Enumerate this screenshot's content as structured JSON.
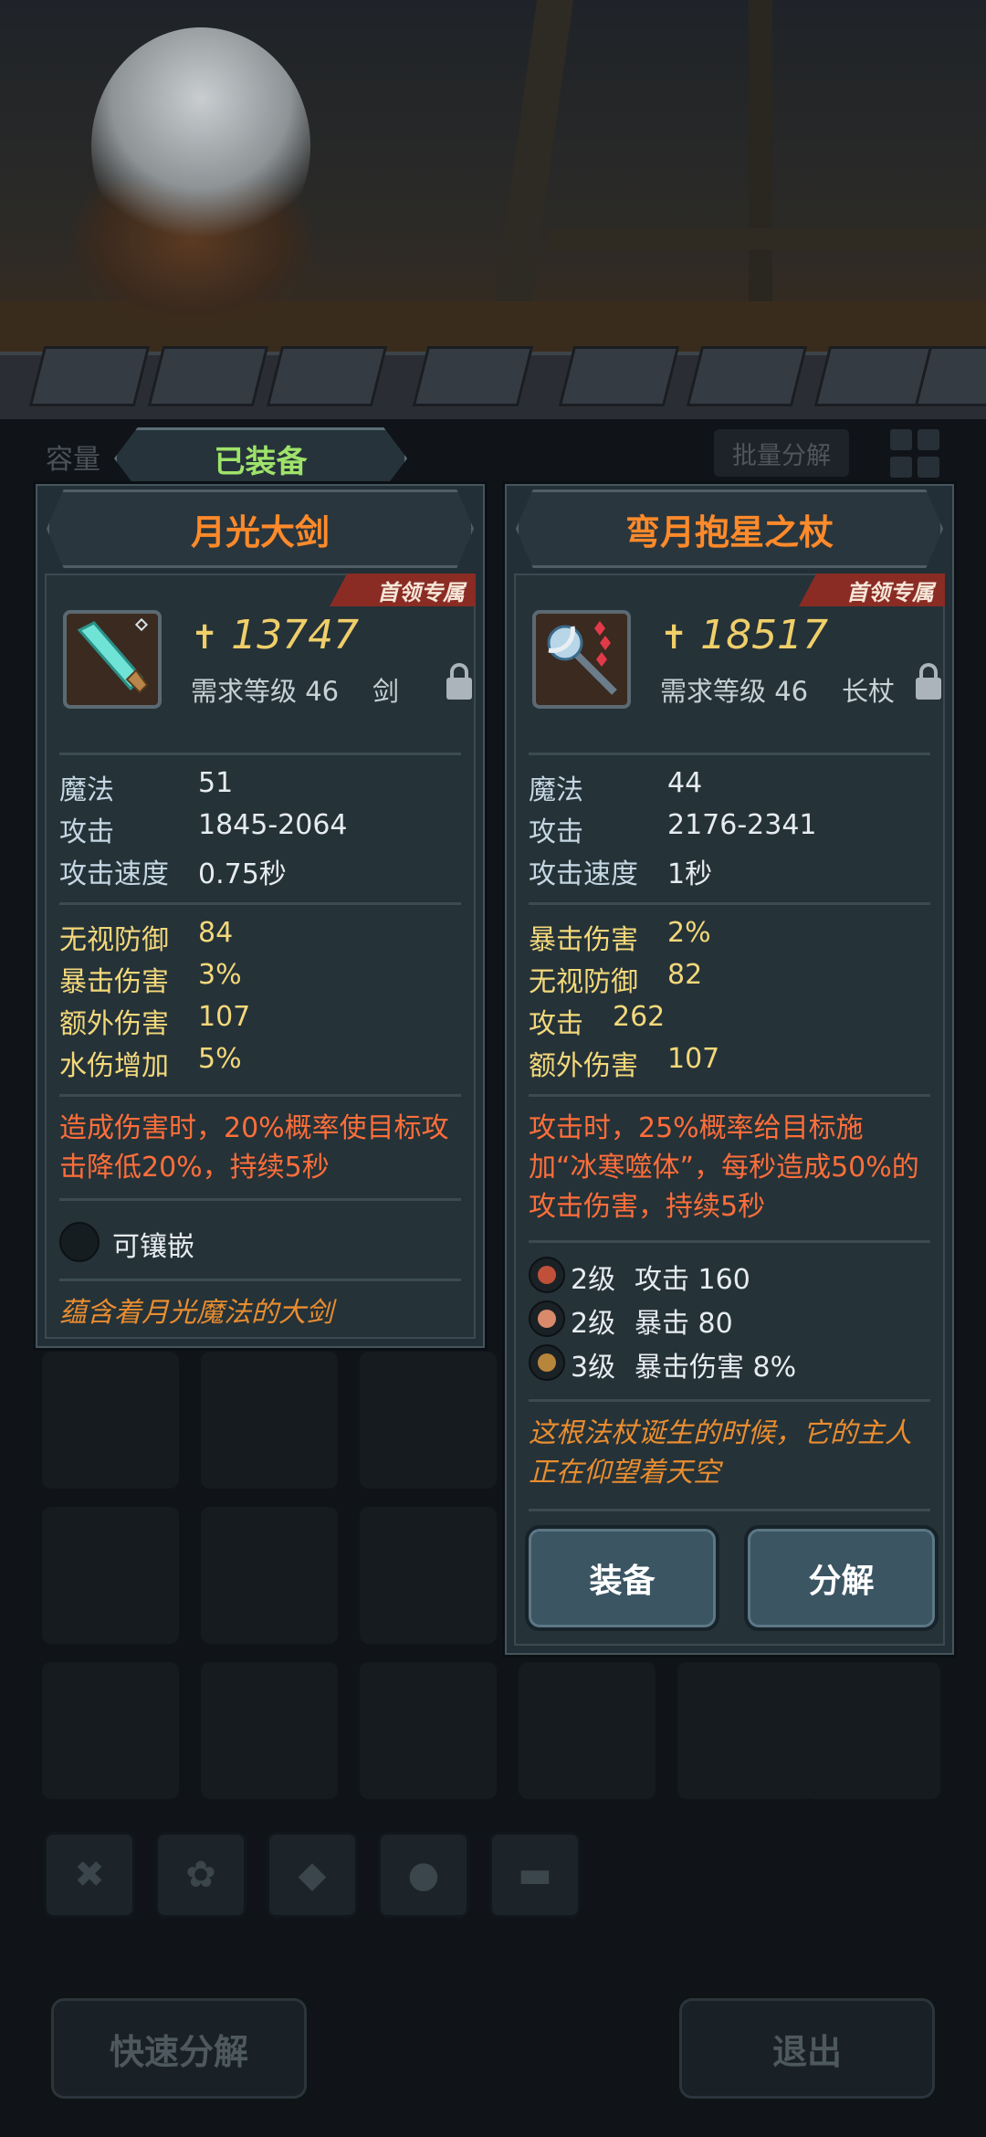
{
  "header": {
    "capacity_label": "容量",
    "equipped_tab": "已装备",
    "bulk_decompose": "批量分解"
  },
  "left_item": {
    "name": "月光大剑",
    "boss_tag": "首领专属",
    "power_symbol": "✝",
    "power": "13747",
    "requirement": "需求等级 46",
    "type": "剑",
    "base_stats": [
      {
        "k": "魔法",
        "v": "51"
      },
      {
        "k": "攻击",
        "v": "1845-2064"
      },
      {
        "k": "攻击速度",
        "v": "0.75秒"
      }
    ],
    "bonus_stats": [
      {
        "k": "无视防御",
        "v": "84"
      },
      {
        "k": "暴击伤害",
        "v": "3%"
      },
      {
        "k": "额外伤害",
        "v": "107"
      },
      {
        "k": "水伤增加",
        "v": "5%"
      }
    ],
    "effect": "造成伤害时，20%概率使目标攻击降低20%，持续5秒",
    "socket_label": "可镶嵌",
    "flavor": "蕴含着月光魔法的大剑"
  },
  "right_item": {
    "name": "弯月抱星之杖",
    "boss_tag": "首领专属",
    "power_symbol": "✝",
    "power": "18517",
    "requirement": "需求等级 46",
    "type": "长杖",
    "base_stats": [
      {
        "k": "魔法",
        "v": "44"
      },
      {
        "k": "攻击",
        "v": "2176-2341"
      },
      {
        "k": "攻击速度",
        "v": "1秒"
      }
    ],
    "bonus_stats": [
      {
        "k": "暴击伤害",
        "v": "2%"
      },
      {
        "k": "无视防御",
        "v": "82"
      },
      {
        "k": "攻击",
        "v": "262"
      },
      {
        "k": "额外伤害",
        "v": "107"
      }
    ],
    "effect": "攻击时，25%概率给目标施加“冰寒噬体”，每秒造成50%的攻击伤害，持续5秒",
    "gems": [
      {
        "level": "2级",
        "stat": "攻击 160",
        "color": "#c0503a"
      },
      {
        "level": "2级",
        "stat": "暴击 80",
        "color": "#d88a6a"
      },
      {
        "level": "3级",
        "stat": "暴击伤害 8%",
        "color": "#b8863a"
      }
    ],
    "flavor": "这根法杖诞生的时候，它的主人正在仰望着天空",
    "equip_button": "装备",
    "decompose_button": "分解"
  },
  "bottom": {
    "quick_decompose": "快速分解",
    "exit": "退出"
  },
  "category_icons": [
    "tools-icon",
    "paw-icon",
    "gem-icon",
    "ore-icon",
    "chest-icon"
  ]
}
